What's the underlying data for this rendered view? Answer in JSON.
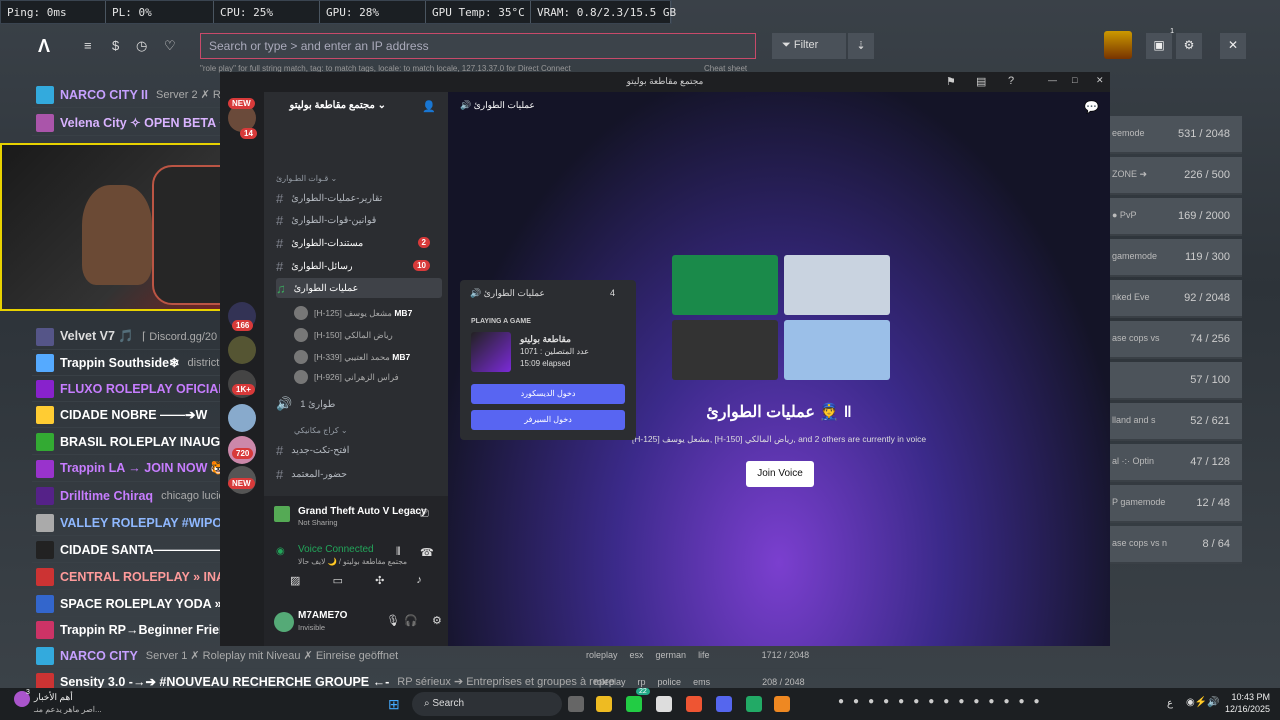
{
  "stats": [
    "Ping: 0ms",
    "PL: 0%",
    "CPU: 25%",
    "GPU: 28%",
    "GPU Temp: 35°C",
    "VRAM: 0.8/2.3/15.5 GB"
  ],
  "fivem": {
    "search_placeholder": "Search or type > and enter an IP address",
    "filter_label": "Filter",
    "hint": "\"role play\" for full string match, tag: to match tags, locale: to match locale, 127.13.37.0 for Direct Connect",
    "cheat_sheet": "Cheat sheet",
    "toolbar_badge": "1"
  },
  "servers": [
    {
      "name": "NARCO CITY II",
      "desc": "Server 2 ✗ Role",
      "color": "#c6a0ff",
      "icon": "#3ad"
    },
    {
      "name": "Velena City ✧ OPEN BETA ✧",
      "desc": "",
      "color": "#d9b3ff",
      "icon": "#a5a"
    },
    {
      "name": "Velvet V7 🎵",
      "desc": "⌈ Discord.gg/20",
      "color": "#dddddd",
      "icon": "#558"
    },
    {
      "name": "Trappin Southside❄",
      "desc": "district",
      "color": "#ffffff",
      "icon": "#5af"
    },
    {
      "name": "FLUXO ROLEPLAY OFICIAL",
      "desc": "",
      "color": "#c77dff",
      "icon": "#82c"
    },
    {
      "name": "CIDADE NOBRE ——➔W",
      "desc": "",
      "color": "#ffffff",
      "icon": "#fc3"
    },
    {
      "name": "BRASIL ROLEPLAY INAUGU",
      "desc": "",
      "color": "#ffffff",
      "icon": "#3a3"
    },
    {
      "name": "Trappin LA → JOIN NOW 🐯",
      "desc": "",
      "color": "#c77dff",
      "icon": "#93c"
    },
    {
      "name": "Drilltime Chiraq",
      "desc": "chicago lucid",
      "color": "#c77dff",
      "icon": "#528"
    },
    {
      "name": "VALLEY ROLEPLAY #WIPOU",
      "desc": "",
      "color": "#8fb8ff",
      "icon": "#aaa"
    },
    {
      "name": "CIDADE SANTA————————",
      "desc": "",
      "color": "#ffffff",
      "icon": "#222"
    },
    {
      "name": "CENTRAL ROLEPLAY » INAU",
      "desc": "",
      "color": "#ff9b9b",
      "icon": "#c33"
    },
    {
      "name": "SPACE ROLEPLAY YODA »»",
      "desc": "",
      "color": "#ffffff",
      "icon": "#36c"
    },
    {
      "name": "Trappin RP→Beginner Frier",
      "desc": "",
      "color": "#ffffff",
      "icon": "#c36"
    },
    {
      "name": "NARCO CITY",
      "desc": "Server 1 ✗ Roleplay mit Niveau ✗ Einreise geöffnet",
      "color": "#c6a0ff",
      "icon": "#3ad"
    },
    {
      "name": "Sensity 3.0 -→➔ #NOUVEAU RECHERCHE GROUPE ←-",
      "desc": "RP sérieux ➔ Entreprises et groupes à repre",
      "color": "#ffffff",
      "icon": "#c33"
    }
  ],
  "bottom_rows": [
    {
      "tags": [
        "roleplay",
        "esx",
        "german",
        "life"
      ],
      "count": "1712 / 2048"
    },
    {
      "tags": [
        "roleplay",
        "rp",
        "police",
        "ems"
      ],
      "count": "208 / 2048"
    }
  ],
  "right_rows": [
    {
      "label": "eemode",
      "count": "531 / 2048"
    },
    {
      "label": "ZONE ➜",
      "count": "226 / 500"
    },
    {
      "label": "● PvP",
      "count": "169 / 2000"
    },
    {
      "label": "gamemode",
      "count": "119 / 300"
    },
    {
      "label": "nked Eve",
      "count": "92 / 2048"
    },
    {
      "label": "ase cops vs",
      "count": "74 / 256"
    },
    {
      "label": "",
      "count": "57 / 100"
    },
    {
      "label": "lland and s",
      "count": "52 / 621"
    },
    {
      "label": "al ·:· Optin",
      "count": "47 / 128"
    },
    {
      "label": "P gamemode",
      "count": "12 / 48"
    },
    {
      "label": "ase cops vs n",
      "count": "8 / 64"
    }
  ],
  "discord": {
    "window_title": "مجتمع مقاطعة بوليتو",
    "server_name": "مجتمع مقاطعة بوليتو",
    "category": "قـوات الطـوارئ",
    "channels": [
      {
        "name": "تقارير-عمليات-الطوارئ",
        "badge": ""
      },
      {
        "name": "قوانين-قوات-الطوارئ",
        "badge": ""
      },
      {
        "name": "مستندات-الطوارئ",
        "badge": "2"
      },
      {
        "name": "رسائل-الطوارئ",
        "badge": "10"
      }
    ],
    "active_channel": "عمليات الطوارئ",
    "voice_users": [
      "[H-125] مشعل يوسف",
      "[H-150] رياض المالكي",
      "[H-339] محمد العتيبي",
      "[H-926] فراس الزهراني"
    ],
    "voice_badge": "MB7",
    "voice2": "طوارئ 1",
    "category2": "كراج مكانيكي",
    "channels2": [
      "افتح-تكت-جديد",
      "حضور-المعتمد"
    ],
    "guild_badges": [
      "NEW",
      "14",
      "166",
      "1K+",
      "720",
      "NEW"
    ],
    "header_channel": "عمليات الطوارئ",
    "big_title": "عمليات الطوارئ 👮 ‖",
    "voice_status": "[H-125] مشعل يوسف, [H-150] رياض المالكي, and 2 others are currently in voice",
    "join_voice": "Join Voice",
    "popup": {
      "channel": "عمليات الطوارئ",
      "count": "4",
      "playing": "PLAYING A GAME",
      "game": "مقاطعة بوليتو",
      "detail": "عدد المتصلين : 1071",
      "elapsed": "15:09 elapsed",
      "btn1": "دخول الديسكورد",
      "btn2": "دخول السيرفر"
    },
    "activity_game": "Grand Theft Auto V Legacy",
    "activity_sub": "Not Sharing",
    "voice_connected": "Voice Connected",
    "voice_connected_sub": "مجتمع مقاطعة بوليتو / 🌙 لايف حالا",
    "username": "M7AME7O",
    "user_status": "Invisible"
  },
  "taskbar": {
    "news_title": "أهم الأخبار",
    "news_sub": "اصر ماهر يدعم منـ...",
    "search": "Search",
    "time": "10:43 PM",
    "date": "12/16/2025",
    "lang": "ع",
    "badge1": "22",
    "badge2": "3"
  }
}
